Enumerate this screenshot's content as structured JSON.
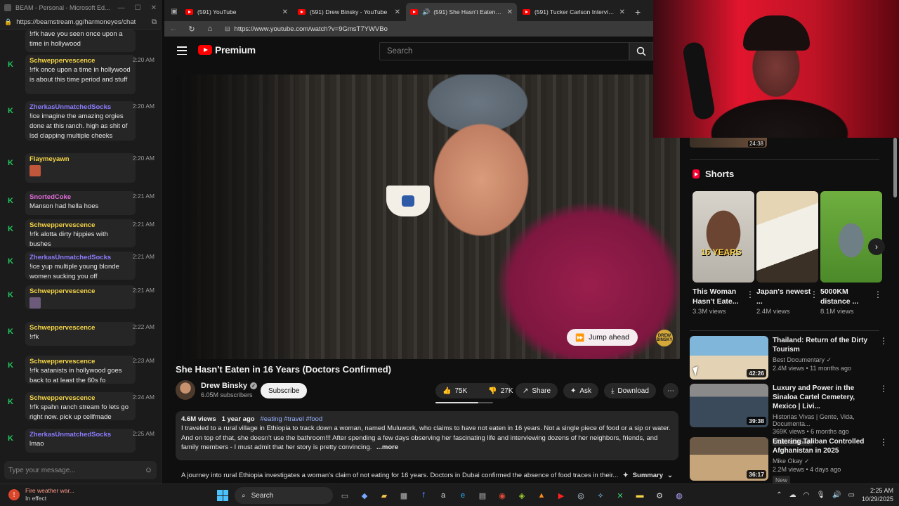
{
  "chat_window": {
    "title": "BEAM - Personal - Microsoft Ed...",
    "url": "https://beamstream.gg/harmoneyes/chat",
    "input_placeholder": "Type your message...",
    "top_fragment": "!rfk have you seen once upon a time in hollywood",
    "messages": [
      {
        "user": "Schweppervescence",
        "color": "#f5d547",
        "time": "2:20 AM",
        "text": "!rfk once upon a time in hollywood is about this time period and stuff"
      },
      {
        "user": "ZherkasUnmatchedSocks",
        "color": "#8b7cff",
        "time": "2:20 AM",
        "text": "!ice imagine the amazing orgies done at this ranch. high as shit of lsd clapping multiple cheeks"
      },
      {
        "user": "Flaymeyawn",
        "color": "#f5d547",
        "time": "2:20 AM",
        "text": "",
        "emote": "#c0563a"
      },
      {
        "user": "SnortedCoke",
        "color": "#e06bd8",
        "time": "2:21 AM",
        "text": "Manson had hella hoes"
      },
      {
        "user": "Schweppervescence",
        "color": "#f5d547",
        "time": "2:21 AM",
        "text": "!rfk alotta dirty hippies with bushes"
      },
      {
        "user": "ZherkasUnmatchedSocks",
        "color": "#8b7cff",
        "time": "2:21 AM",
        "text": "!ice yup multiple young blonde women sucking you off"
      },
      {
        "user": "Schweppervescence",
        "color": "#f5d547",
        "time": "2:21 AM",
        "text": "",
        "emote": "#6b5a7a"
      },
      {
        "user": "Schweppervescence",
        "color": "#f5d547",
        "time": "2:22 AM",
        "text": "!rfk"
      },
      {
        "user": "Schweppervescence",
        "color": "#f5d547",
        "time": "2:23 AM",
        "text": "!rfk satanists in hollywood goes back to at least the 60s fo"
      },
      {
        "user": "Schweppervescence",
        "color": "#f5d547",
        "time": "2:24 AM",
        "text": "!rfk spahn ranch stream fo lets go right now. pick up cellfmade"
      },
      {
        "user": "ZherkasUnmatchedSocks",
        "color": "#8b7cff",
        "time": "2:25 AM",
        "text": "lmao"
      }
    ]
  },
  "browser": {
    "tabs": [
      {
        "label": "(591) YouTube",
        "active": false
      },
      {
        "label": "(591) Drew Binsky - YouTube",
        "active": false
      },
      {
        "label": "(591) She Hasn't Eaten in 16",
        "active": true
      },
      {
        "label": "(591) Tucker Carlson Interviews N",
        "active": false
      }
    ],
    "url": "https://www.youtube.com/watch?v=9GmsT7YWVBo"
  },
  "youtube": {
    "logo_text": "Premium",
    "search_placeholder": "Search",
    "video": {
      "title": "She Hasn't Eaten in 16 Years (Doctors Confirmed)",
      "jump_ahead": "Jump ahead",
      "brand_badge": "DREW BINSKY",
      "channel": "Drew Binsky",
      "subscribers": "6.05M subscribers",
      "subscribe_label": "Subscribe",
      "likes": "75K",
      "dislikes": "27K",
      "like_ratio": 0.74,
      "share": "Share",
      "ask": "Ask",
      "download": "Download",
      "views": "4.6M views",
      "age": "1 year ago",
      "hashtags": "#eating #travel #food",
      "description": "I traveled to a rural village in Ethiopia to track down a woman, named Muluwork, who claims to have not eaten in 16 years.  Not a single piece of food or a sip or water. And on top of that, she doesn't use the bathroom!!! After spending a few days observing her fascinating life and interviewing dozens of her neighbors, friends, and family members - I must admit that her story is pretty convincing.",
      "more_label": "...more",
      "ai_summary": "A journey into rural Ethiopia investigates a woman's claim of not eating for 16 years. Doctors in Dubai confirmed the absence of food traces in their...",
      "summary_label": "Summary"
    },
    "prev_duration": "24:38",
    "shorts_heading": "Shorts",
    "shorts": [
      {
        "title": "This Woman Hasn't Eate...",
        "views": "3.3M views",
        "overlay": "16 YEARS"
      },
      {
        "title": "Japan's newest ...",
        "views": "2.4M views",
        "overlay": ""
      },
      {
        "title": "5000KM distance ...",
        "views": "8.1M views",
        "overlay": ""
      }
    ],
    "recommendations": [
      {
        "title": "Thailand: Return of the Dirty Tourism",
        "channel": "Best Documentary",
        "meta": "2.4M views • 11 months ago",
        "duration": "42:26",
        "tag": ""
      },
      {
        "title": "Luxury and Power in the Sinaloa Cartel Cemetery, Mexico | Livi...",
        "channel": "Historias Vivas | Gente, Vida, Documenta...",
        "meta": "369K views • 6 months ago",
        "duration": "39:38",
        "tag": "Auto-dubbed"
      },
      {
        "title": "Entering Taliban Controlled Afghanistan in 2025",
        "channel": "Mike Okay",
        "meta": "2.2M views • 4 days ago",
        "duration": "36:17",
        "tag": "New"
      }
    ]
  },
  "taskbar": {
    "weather_title": "Fire weather war...",
    "weather_sub": "In effect",
    "search_label": "Search",
    "time": "2:25 AM",
    "date": "10/29/2025"
  },
  "colors": {
    "accent_red": "#ff0000",
    "chat_k": "#22c55e",
    "link_blue": "#9ab4ff"
  }
}
